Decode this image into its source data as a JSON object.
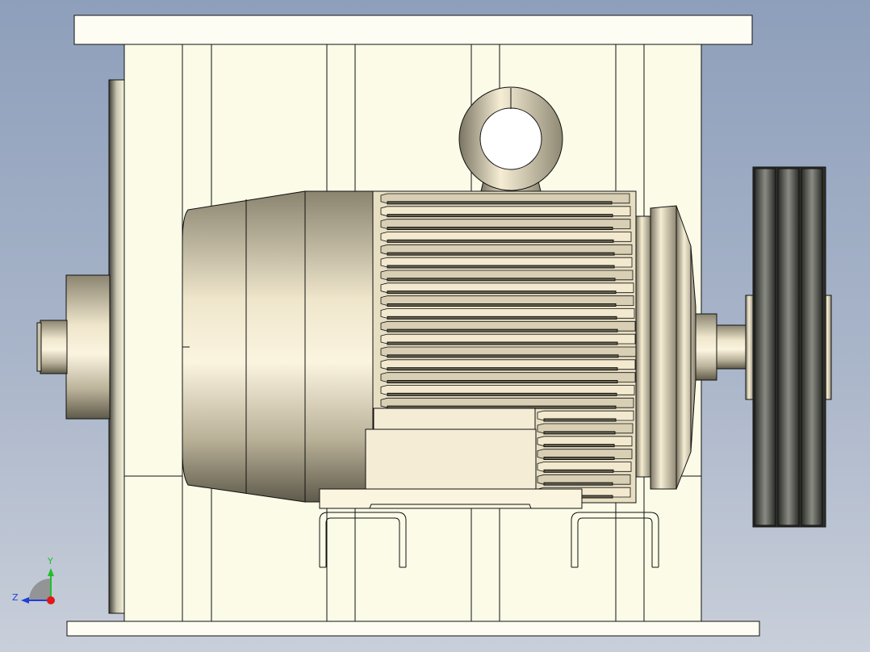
{
  "viewport": {
    "background_top": "#8e9fbb",
    "background_bottom": "#c9cfda"
  },
  "model": {
    "description_items": [
      "frame",
      "electric-motor",
      "eye-bolt",
      "cooling-fins",
      "terminal-box",
      "base-mount",
      "v-belt-pulley",
      "coupling-shaft"
    ]
  },
  "triad": {
    "y_label": "Y",
    "z_label": "Z",
    "colors": {
      "y": "#1fbf2a",
      "z": "#1f3fd8",
      "x": "#e01818"
    }
  },
  "colors": {
    "frame_fill": "#fbfbe8",
    "frame_stroke": "#111111",
    "motor_light": "#f3ead2",
    "motor_dark": "#6b6552",
    "pulley_dark": "#2f312b"
  }
}
